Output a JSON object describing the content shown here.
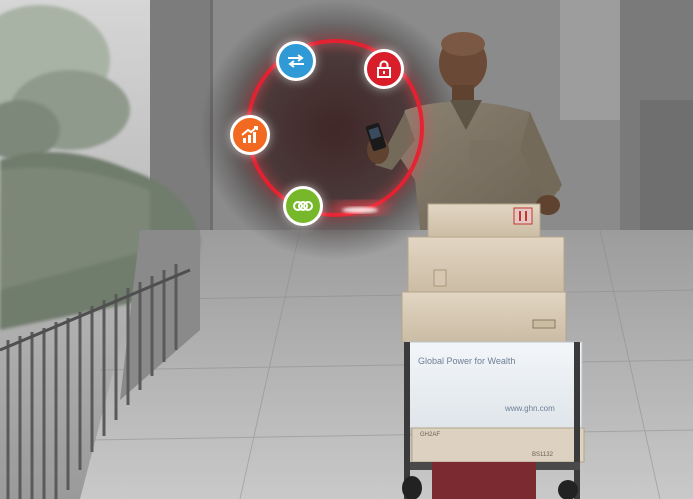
{
  "scene": {
    "description_kind": "photo",
    "labels_on_box": {
      "top_line": "Global Power for Wealth",
      "url": "www.ghn.com",
      "box_code_left": "GH2AF",
      "box_code_right": "BS1132"
    }
  },
  "overlay": {
    "ring_color": "#e3192a",
    "icons": [
      {
        "name": "data-transfer-icon",
        "color": "#2f9ad6"
      },
      {
        "name": "lock-icon",
        "color": "#d81e2b"
      },
      {
        "name": "growth-chart-icon",
        "color": "#f26a21"
      },
      {
        "name": "linked-rings-icon",
        "color": "#76b82a"
      }
    ]
  }
}
